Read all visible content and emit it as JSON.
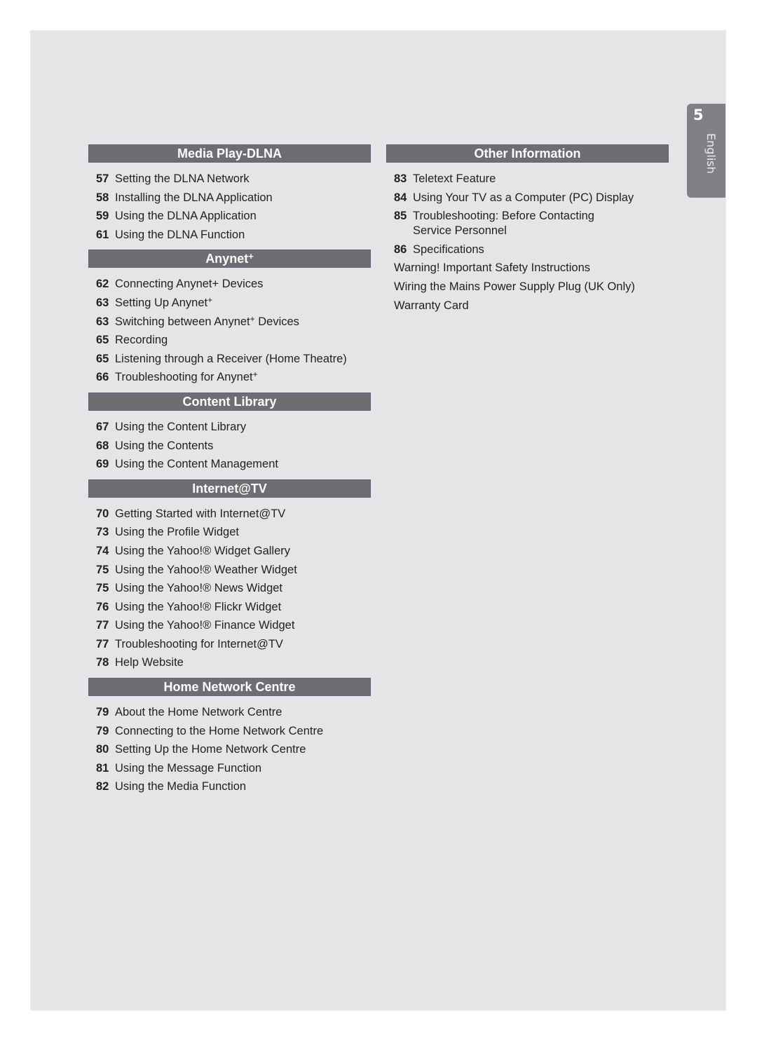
{
  "page_tab": {
    "page_number": "5",
    "language": "English"
  },
  "left_column": [
    {
      "title": "Media Play-DLNA",
      "items": [
        {
          "page": "57",
          "label": "Setting the DLNA Network"
        },
        {
          "page": "58",
          "label": "Installing the DLNA Application"
        },
        {
          "page": "59",
          "label": "Using the DLNA Application"
        },
        {
          "page": "61",
          "label": "Using the DLNA Function"
        }
      ]
    },
    {
      "title": "Anynet",
      "title_sup": "+",
      "items": [
        {
          "page": "62",
          "label": "Connecting Anynet+ Devices"
        },
        {
          "page": "63",
          "label": "Setting Up Anynet",
          "sup": "+"
        },
        {
          "page": "63",
          "label": "Switching between Anynet",
          "sup": "+",
          "suffix": " Devices"
        },
        {
          "page": "65",
          "label": "Recording"
        },
        {
          "page": "65",
          "label": "Listening through a Receiver (Home Theatre)"
        },
        {
          "page": "66",
          "label": "Troubleshooting for Anynet",
          "sup": "+"
        }
      ]
    },
    {
      "title": "Content Library",
      "items": [
        {
          "page": "67",
          "label": "Using the Content Library"
        },
        {
          "page": "68",
          "label": "Using the Contents"
        },
        {
          "page": "69",
          "label": "Using the Content Management"
        }
      ]
    },
    {
      "title": "Internet@TV",
      "items": [
        {
          "page": "70",
          "label": "Getting Started with Internet@TV"
        },
        {
          "page": "73",
          "label": "Using the Profile Widget"
        },
        {
          "page": "74",
          "label": "Using the Yahoo!® Widget Gallery"
        },
        {
          "page": "75",
          "label": "Using the Yahoo!® Weather Widget"
        },
        {
          "page": "75",
          "label": "Using the Yahoo!® News Widget"
        },
        {
          "page": "76",
          "label": "Using the Yahoo!® Flickr Widget"
        },
        {
          "page": "77",
          "label": "Using the Yahoo!® Finance Widget"
        },
        {
          "page": "77",
          "label": "Troubleshooting for Internet@TV"
        },
        {
          "page": "78",
          "label": "Help Website"
        }
      ]
    },
    {
      "title": "Home Network Centre",
      "items": [
        {
          "page": "79",
          "label": "About the Home Network Centre"
        },
        {
          "page": "79",
          "label": "Connecting to the Home Network Centre"
        },
        {
          "page": "80",
          "label": "Setting Up the Home Network Centre"
        },
        {
          "page": "81",
          "label": "Using the Message Function"
        },
        {
          "page": "82",
          "label": "Using the Media Function"
        }
      ]
    }
  ],
  "right_column": [
    {
      "title": "Other Information",
      "items": [
        {
          "page": "83",
          "label": "Teletext Feature"
        },
        {
          "page": "84",
          "label": "Using Your TV as a Computer (PC) Display"
        },
        {
          "page": "85",
          "label": "Troubleshooting: Before Contacting\nService Personnel",
          "multiline": true
        },
        {
          "page": "86",
          "label": "Specifications"
        },
        {
          "page": "",
          "label": "Warning! Important Safety Instructions"
        },
        {
          "page": "",
          "label": "Wiring the Mains Power Supply Plug (UK Only)"
        },
        {
          "page": "",
          "label": "Warranty Card"
        }
      ]
    }
  ],
  "colors": {
    "page_background": "#e4e5e6",
    "header_fill": "#6d6e71",
    "tab_fill": "#808184",
    "text": "#231f20"
  }
}
